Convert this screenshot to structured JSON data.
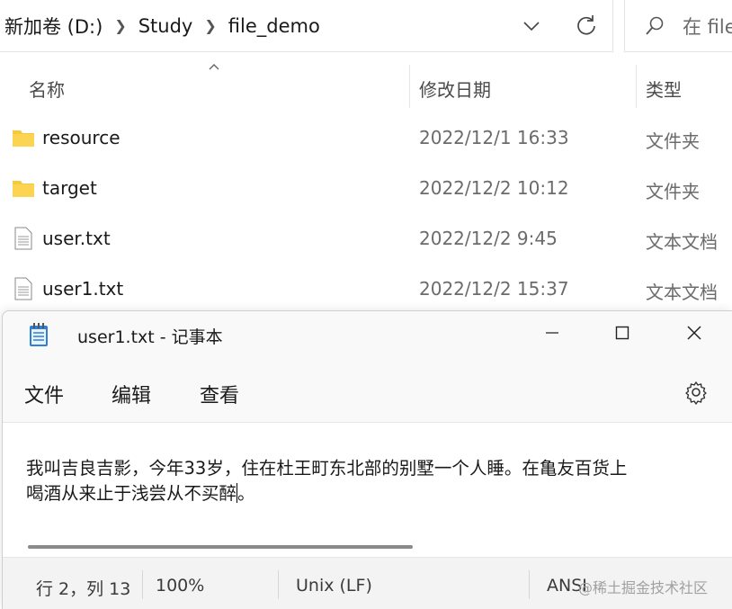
{
  "explorer": {
    "breadcrumb": [
      "新加卷 (D:)",
      "Study",
      "file_demo"
    ],
    "search_placeholder": "在 file",
    "columns": {
      "name": "名称",
      "date": "修改日期",
      "type": "类型"
    },
    "files": [
      {
        "name": "resource",
        "date": "2022/12/1 16:33",
        "type": "文件夹",
        "icon": "folder-icon"
      },
      {
        "name": "target",
        "date": "2022/12/2 10:12",
        "type": "文件夹",
        "icon": "folder-icon"
      },
      {
        "name": "user.txt",
        "date": "2022/12/2 9:45",
        "type": "文本文档",
        "icon": "text-file-icon"
      },
      {
        "name": "user1.txt",
        "date": "2022/12/2 15:37",
        "type": "文本文档",
        "icon": "text-file-icon"
      }
    ]
  },
  "notepad": {
    "title": "user1.txt - 记事本",
    "menu": [
      "文件",
      "编辑",
      "查看"
    ],
    "content": {
      "line1": "我叫吉良吉影，今年33岁，住在杜王町东北部的别墅一个人睡。在亀友百货上",
      "line2a": "喝酒从来止于浅尝从不买醉",
      "line2b": "。"
    },
    "status": {
      "position": "行 2，列 13",
      "zoom": "100%",
      "line_ending": "Unix (LF)",
      "encoding": "ANSI"
    }
  },
  "watermark": "@稀土掘金技术社区",
  "colors": {
    "folder": "#f8c83b",
    "notepad_icon": "#2f7fd3"
  }
}
